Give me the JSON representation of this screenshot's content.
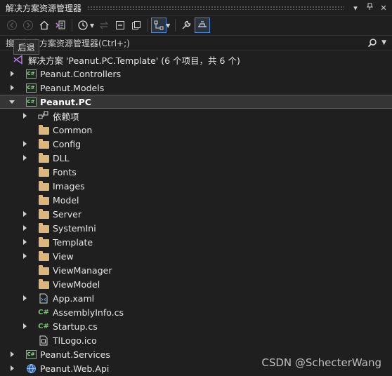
{
  "window": {
    "title": "解决方案资源管理器",
    "pin_glyph": "▾",
    "close_glyph": "✕"
  },
  "tooltip": {
    "text": "后退"
  },
  "search": {
    "placeholder": "搜索解决方案资源管理器(Ctrl+;)",
    "icon": "search-icon"
  },
  "tree": {
    "solution_label": "解决方案 'Peanut.PC.Template' (6 个项目，共 6 个)",
    "items": [
      {
        "label": "Peanut.Controllers",
        "icon": "csharp-project-icon"
      },
      {
        "label": "Peanut.Models",
        "icon": "csharp-project-icon"
      },
      {
        "label": "Peanut.PC",
        "icon": "csharp-project-icon",
        "selected": true
      },
      {
        "label": "依赖项",
        "icon": "dependencies-icon"
      },
      {
        "label": "Common",
        "icon": "folder-icon"
      },
      {
        "label": "Config",
        "icon": "folder-icon"
      },
      {
        "label": "DLL",
        "icon": "folder-icon"
      },
      {
        "label": "Fonts",
        "icon": "folder-icon"
      },
      {
        "label": "Images",
        "icon": "folder-icon"
      },
      {
        "label": "Model",
        "icon": "folder-icon"
      },
      {
        "label": "Server",
        "icon": "folder-icon"
      },
      {
        "label": "SystemIni",
        "icon": "folder-icon"
      },
      {
        "label": "Template",
        "icon": "folder-icon"
      },
      {
        "label": "View",
        "icon": "folder-icon"
      },
      {
        "label": "ViewManager",
        "icon": "folder-icon"
      },
      {
        "label": "ViewModel",
        "icon": "folder-icon"
      },
      {
        "label": "App.xaml",
        "icon": "xaml-file-icon"
      },
      {
        "label": "AssemblyInfo.cs",
        "icon": "csharp-file-icon"
      },
      {
        "label": "Startup.cs",
        "icon": "csharp-file-icon"
      },
      {
        "label": "TlLogo.ico",
        "icon": "ico-file-icon"
      },
      {
        "label": "Peanut.Services",
        "icon": "csharp-project-icon"
      },
      {
        "label": "Peanut.Web.Api",
        "icon": "web-project-icon"
      }
    ]
  },
  "watermark": "CSDN @SchecterWang",
  "colors": {
    "background": "#1f1f1f",
    "selection": "#353535",
    "accent": "#4f8ad6",
    "folder": "#dcb67a",
    "csharp": "#6fc26a"
  }
}
